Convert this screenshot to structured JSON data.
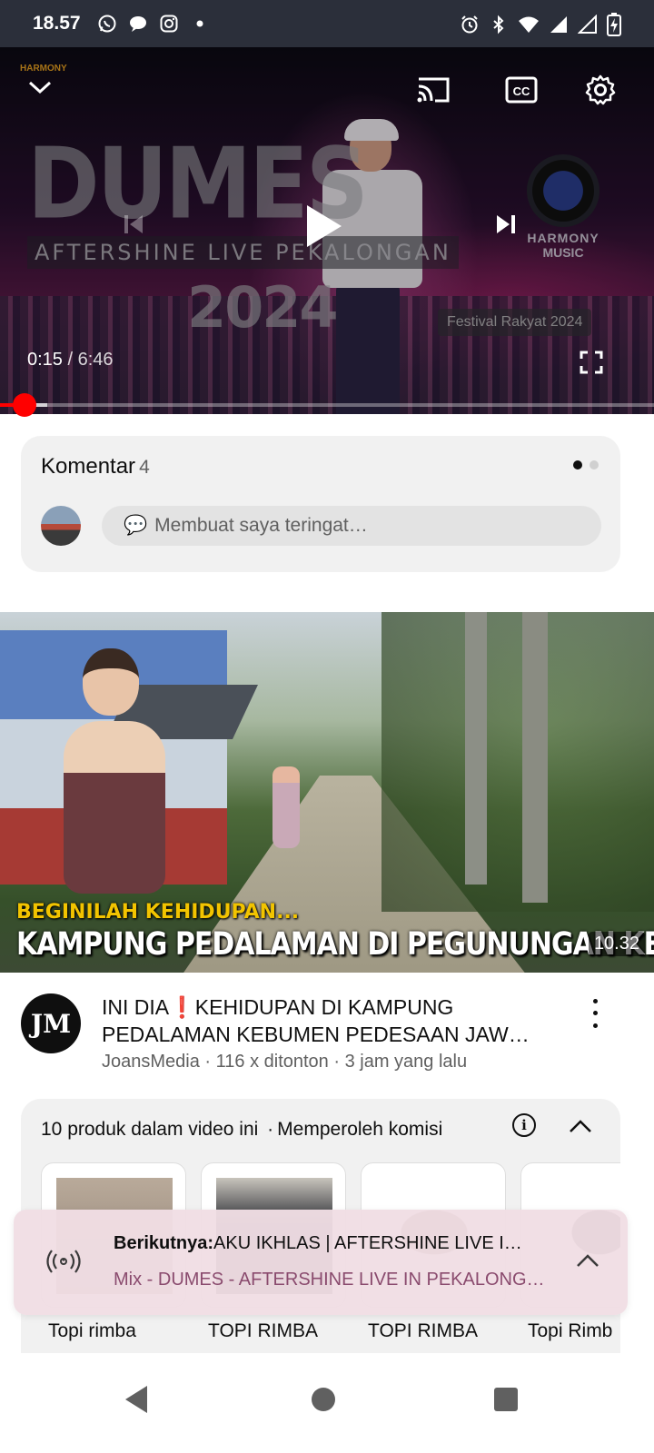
{
  "status_bar": {
    "time": "18.57",
    "left_icons": [
      "whatsapp-icon",
      "chat-bubble-icon",
      "instagram-icon",
      "dot-icon"
    ],
    "right_icons": [
      "alarm-icon",
      "bluetooth-icon",
      "wifi-icon",
      "signal-icon",
      "signal-icon",
      "battery-charging-icon"
    ]
  },
  "player": {
    "thumbnail": {
      "title": "DUMES",
      "subtitle": "AFTERSHINE LIVE PEKALONGAN",
      "year": "2024",
      "festival": "Festival Rakyat 2024",
      "logo_line1": "HARMONY",
      "logo_line2": "MUSIC"
    },
    "current_time": "0:15",
    "duration": "6:46",
    "time_separator": " / ",
    "progress_fraction": 0.037,
    "buffer_fraction": 0.072,
    "controls": [
      "chevron-down-icon",
      "cast-icon",
      "captions-icon",
      "settings-gear-icon",
      "previous-icon",
      "play-icon",
      "next-icon",
      "fullscreen-icon"
    ]
  },
  "comments": {
    "label": "Komentar",
    "count": "4",
    "input_placeholder": "Membuat saya teringat…",
    "input_emoji": "💬"
  },
  "video": {
    "thumbnail_caption_1": "BEGINILAH KEHIDUPAN...",
    "thumbnail_caption_2": "KAMPUNG PEDALAMAN DI PEGUNUNGAN KEBUMEN",
    "duration": "10.32",
    "channel_initials": "JM",
    "title": "INI DIA❗KEHIDUPAN DI KAMPUNG PEDALAMAN KEBUMEN PEDESAAN JAW…",
    "channel": "JoansMedia",
    "views": "116 x ditonton",
    "age": "3 jam yang lalu",
    "meta_sep": " · "
  },
  "products": {
    "header": "10 produk dalam video ini",
    "sep": "·",
    "commission": "Memperoleh komisi",
    "items": [
      {
        "label": "Topi rimba"
      },
      {
        "label": "TOPI RIMBA"
      },
      {
        "label": "TOPI RIMBA"
      },
      {
        "label": "Topi Rimb"
      }
    ]
  },
  "up_next": {
    "prefix": "Berikutnya:",
    "title": "AKU IKHLAS | AFTERSHINE LIVE I…",
    "playlist": "Mix - DUMES - AFTERSHINE LIVE IN PEKALONG…"
  },
  "colors": {
    "accent_red": "#ff0000",
    "surface": "#f1f1f1",
    "secondary_text": "#606060",
    "up_next_bg": "#f0dee4",
    "playlist_text": "#8a4b6e",
    "status_bar_bg": "#2b2f3a"
  }
}
